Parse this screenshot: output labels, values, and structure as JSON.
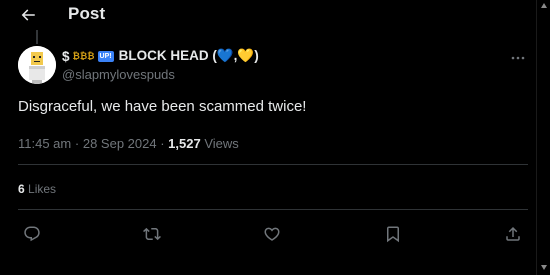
{
  "header": {
    "title": "Post",
    "back_icon": "arrow-left-icon"
  },
  "author": {
    "name_prefix": "$",
    "money_glyph": "₿₿₿",
    "up_badge": "UP!",
    "name": "BLOCK HEAD (💙,💛)",
    "handle": "@slapmylovespuds",
    "avatar_icon": "roblox-blockhead-avatar"
  },
  "tweet": {
    "text": "Disgraceful, we have been scammed twice!"
  },
  "meta": {
    "time": "11:45 am",
    "date": "28 Sep 2024",
    "separator": "·",
    "views_count": "1,527",
    "views_label": "Views"
  },
  "stats": {
    "likes_count": "6",
    "likes_label": "Likes"
  },
  "actions": [
    {
      "name": "reply",
      "icon": "comment-icon"
    },
    {
      "name": "repost",
      "icon": "retweet-icon"
    },
    {
      "name": "like",
      "icon": "heart-icon"
    },
    {
      "name": "bookmark",
      "icon": "bookmark-icon"
    },
    {
      "name": "share",
      "icon": "share-icon"
    }
  ],
  "colors": {
    "background": "#000000",
    "text_primary": "#e7e9ea",
    "text_secondary": "#71767b",
    "divider": "#2f3336",
    "badge_blue": "#3b82f6"
  }
}
